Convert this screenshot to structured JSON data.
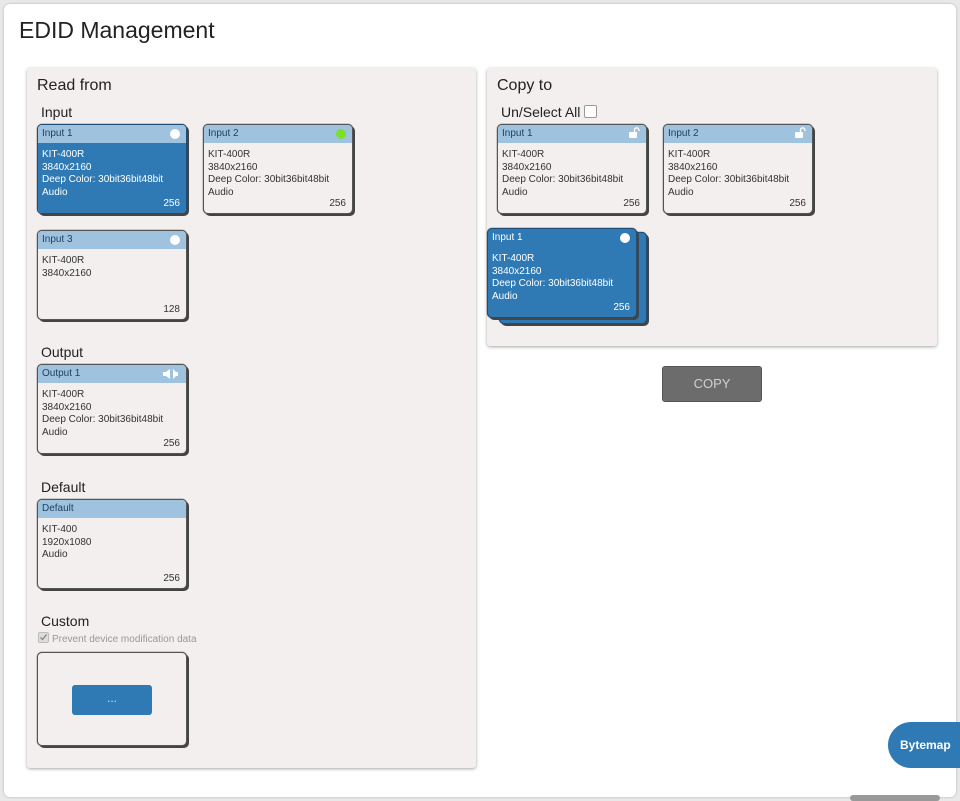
{
  "page": {
    "title": "EDID Management"
  },
  "read_from": {
    "title": "Read from",
    "input_label": "Input",
    "output_label": "Output",
    "default_label": "Default",
    "custom_label": "Custom",
    "prevent_label": "Prevent device modification data",
    "inputs": [
      {
        "header": "Input 1",
        "lines": [
          "KIT-400R",
          "3840x2160",
          "Deep Color: 30bit36bit48bit",
          "Audio"
        ],
        "count": "256",
        "status": "white-dot",
        "selected": true
      },
      {
        "header": "Input 2",
        "lines": [
          "KIT-400R",
          "3840x2160",
          "Deep Color: 30bit36bit48bit",
          "Audio"
        ],
        "count": "256",
        "status": "green-dot",
        "selected": false
      },
      {
        "header": "Input 3",
        "lines": [
          "KIT-400R",
          "3840x2160"
        ],
        "count": "128",
        "status": "white-dot",
        "selected": false
      }
    ],
    "output": {
      "header": "Output 1",
      "lines": [
        "KIT-400R",
        "3840x2160",
        "Deep Color: 30bit36bit48bit",
        "Audio"
      ],
      "count": "256",
      "icon": "speaker-icon"
    },
    "default": {
      "header": "Default",
      "lines": [
        "KIT-400",
        "1920x1080",
        "Audio"
      ],
      "count": "256"
    },
    "custom_button_label": "..."
  },
  "copy_to": {
    "title": "Copy to",
    "select_all_label": "Un/Select All",
    "targets": [
      {
        "header": "Input 1",
        "lines": [
          "KIT-400R",
          "3840x2160",
          "Deep Color: 30bit36bit48bit",
          "Audio"
        ],
        "count": "256",
        "icon": "unlock-icon"
      },
      {
        "header": "Input 2",
        "lines": [
          "KIT-400R",
          "3840x2160",
          "Deep Color: 30bit36bit48bit",
          "Audio"
        ],
        "count": "256",
        "icon": "unlock-icon"
      }
    ],
    "dragging": {
      "header": "Input 1",
      "lines": [
        "KIT-400R",
        "3840x2160",
        "Deep Color: 30bit36bit48bit",
        "Audio"
      ],
      "count": "256"
    },
    "copy_button_label": "COPY"
  },
  "bytemap_label": "Bytemap",
  "colors": {
    "accent": "#2f7ab5",
    "card_header": "#9fc3de",
    "panel": "#f2efee",
    "status_green": "#7ce02a"
  }
}
